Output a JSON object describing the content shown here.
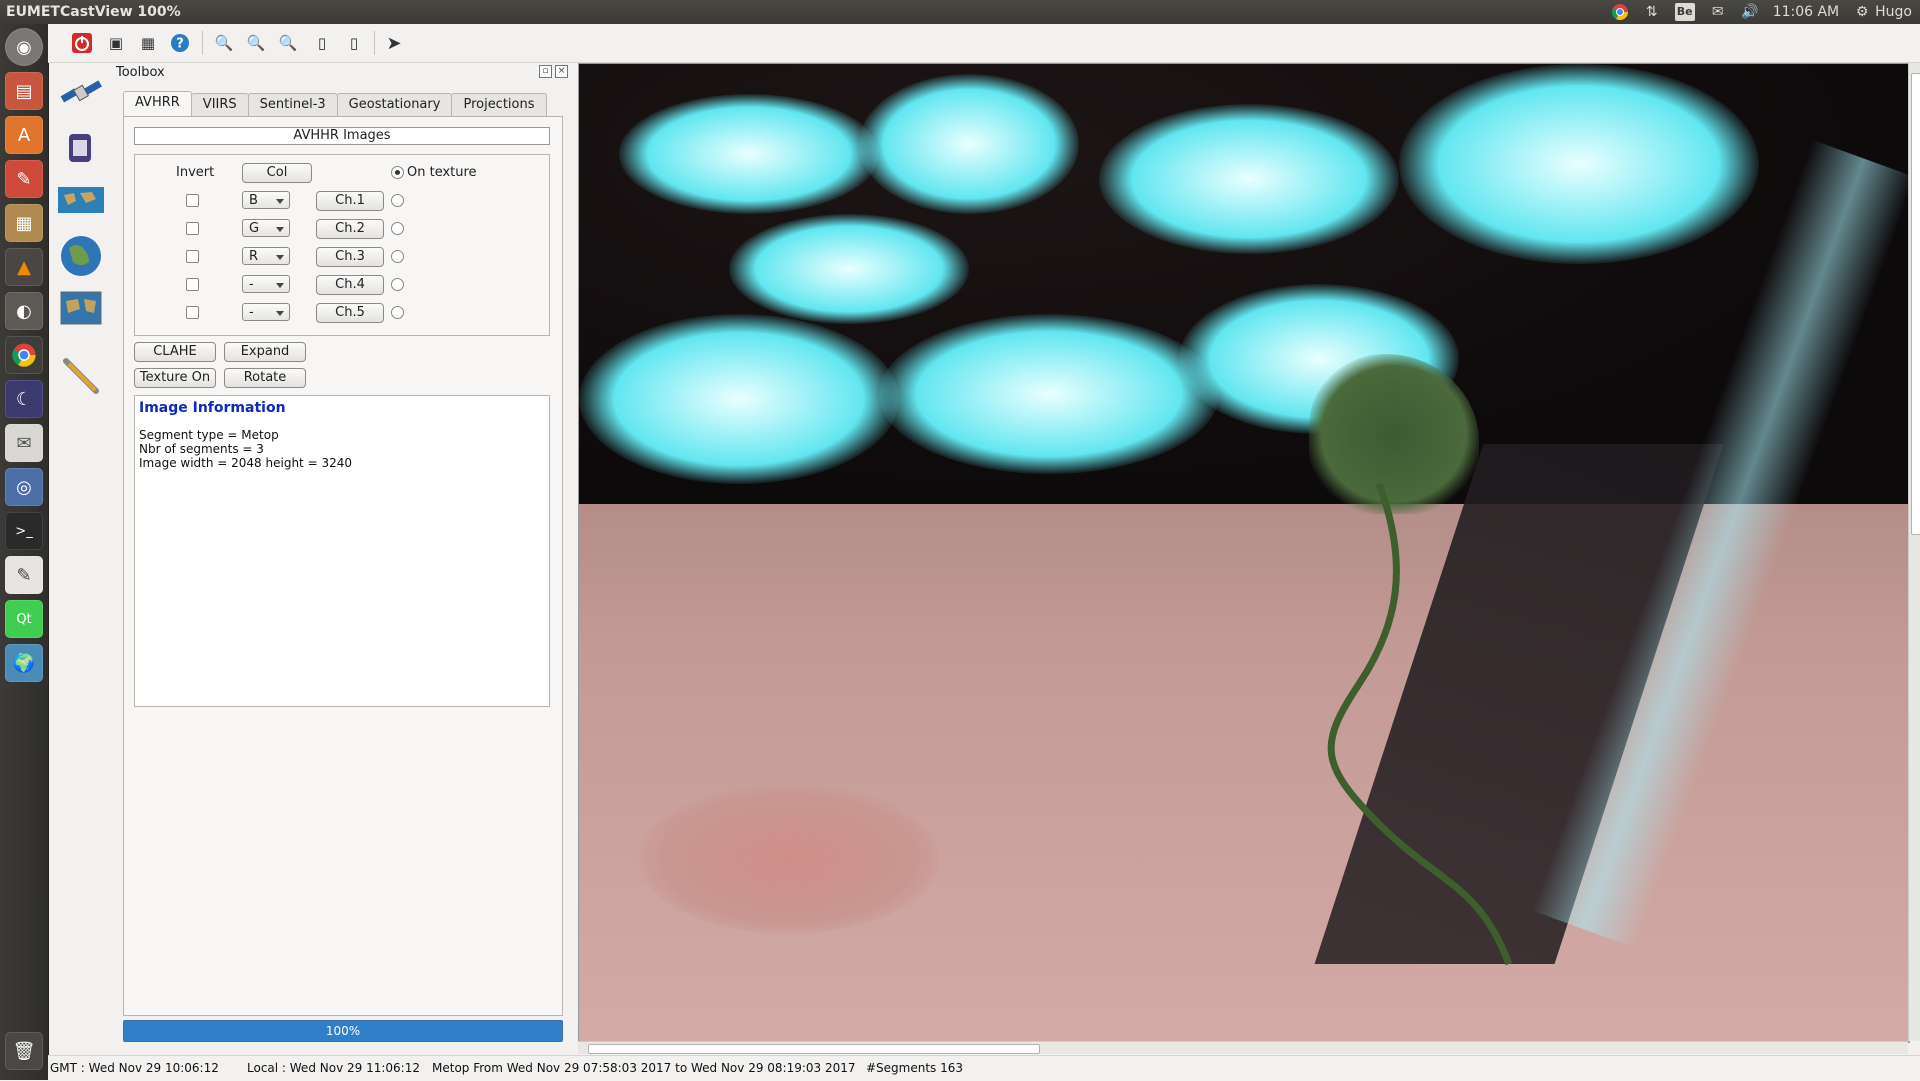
{
  "window": {
    "title": "EUMETCastView 100%"
  },
  "tray": {
    "chrome": "chrome-icon",
    "network": "network-icon",
    "keyboard_layout": "Be",
    "mail": "mail-icon",
    "volume": "volume-icon",
    "time": "11:06 AM",
    "user": "Hugo"
  },
  "launcher": {
    "items": [
      "dash-home",
      "files",
      "software-center",
      "settings",
      "archive-manager",
      "vlc",
      "gimp",
      "chrome",
      "stellarium",
      "mail",
      "browser",
      "terminal",
      "text-editor",
      "qt-creator",
      "eumetcastview",
      "trash"
    ]
  },
  "toolbar": {
    "buttons": [
      "quit",
      "screenshot",
      "snapshot",
      "help",
      "zoom-out",
      "zoom-in",
      "zoom-fit",
      "overlay",
      "overlay-2",
      "pointer"
    ]
  },
  "toolbox": {
    "title": "Toolbox",
    "tabs": [
      "AVHRR",
      "VIIRS",
      "Sentinel-3",
      "Geostationary",
      "Projections"
    ],
    "active_tab": "AVHRR",
    "group_title": "AVHHR Images",
    "invert_label": "Invert",
    "col_button": "Col",
    "on_texture_label": "On texture",
    "channels": [
      {
        "color": "B",
        "button": "Ch.1"
      },
      {
        "color": "G",
        "button": "Ch.2"
      },
      {
        "color": "R",
        "button": "Ch.3"
      },
      {
        "color": "-",
        "button": "Ch.4"
      },
      {
        "color": "-",
        "button": "Ch.5"
      }
    ],
    "clahe_button": "CLAHE",
    "expand_button": "Expand",
    "texture_button": "Texture On",
    "rotate_button": "Rotate",
    "info": {
      "title": "Image Information",
      "lines": [
        "Segment type = Metop",
        "Nbr of segments = 3",
        "Image width = 2048 height = 3240"
      ]
    },
    "progress_text": "100%",
    "progress_value": 1.0
  },
  "status": {
    "gmt": "GMT : Wed Nov 29 10:06:12",
    "local": "Local : Wed Nov 29 11:06:12",
    "metop": "Metop From Wed Nov 29 07:58:03 2017 to Wed Nov 29 08:19:03 2017",
    "segments": "#Segments 163"
  },
  "colors": {
    "accent_blue": "#2f7fc9",
    "info_title": "#0b2bb8",
    "quit_red": "#d22b2b"
  }
}
